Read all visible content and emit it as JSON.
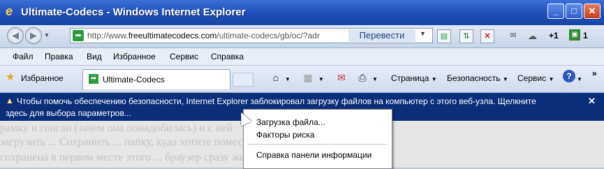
{
  "window": {
    "title": "Ultimate-Codecs - Windows Internet Explorer",
    "buttons": [
      "min",
      "max",
      "close"
    ]
  },
  "address_bar": {
    "url_prefix": "http://www.",
    "url_domain": "freeultimatecodecs.com",
    "url_path": "/ultimate-codecs/gb/oc/?adr",
    "translate_label": "Перевести",
    "plus_one": "+1",
    "ext_count": "1"
  },
  "menu": {
    "items": [
      "Файл",
      "Правка",
      "Вид",
      "Избранное",
      "Сервис",
      "Справка"
    ]
  },
  "toolbar": {
    "favorites_label": "Избранное",
    "tab_label": "Ultimate-Codecs",
    "page_label": "Страница",
    "safety_label": "Безопасность",
    "tools_label": "Сервис",
    "help_icon_label": "?",
    "chevron": "»"
  },
  "info_bar": {
    "line1": "Чтобы помочь обеспечению безопасности, Internet Explorer заблокировал загрузку файлов на компьютер с этого веб-узла. Щелкните",
    "line2": "здесь для выбора параметров..."
  },
  "context_menu": {
    "items": [
      "Загрузка файла...",
      "Факторы риска",
      "Справка панели информации"
    ]
  },
  "page_background": {
    "lines": [
      "рамку и гонган (зачем она понадобилась) и с ней",
      "загрузить ... Сохранить ... папку, куда хотите помес",
      "сохранена в первом месте этого ... браузер сразу же вс"
    ]
  }
}
